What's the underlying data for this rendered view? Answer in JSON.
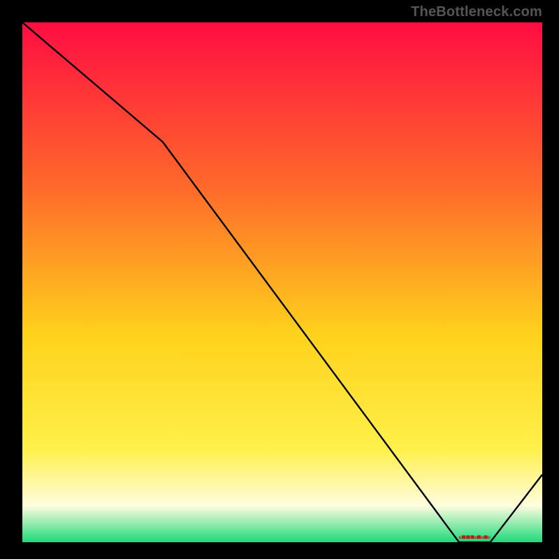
{
  "watermark": "TheBottleneck.com",
  "colors": {
    "grad_top": "#ff0d42",
    "grad_upper_mid": "#ff6a2a",
    "grad_mid": "#ffd21c",
    "grad_low_yellow": "#fff04a",
    "grad_pale": "#fffde0",
    "grad_green": "#1fd97a",
    "line": "#000000",
    "marker": "#b3231a",
    "border": "#000000"
  },
  "chart_data": {
    "type": "line",
    "title": "",
    "xlabel": "",
    "ylabel": "",
    "xlim": [
      0,
      100
    ],
    "ylim": [
      0,
      100
    ],
    "x": [
      0,
      27,
      84,
      90,
      100
    ],
    "values": [
      100,
      77,
      0,
      0,
      13
    ],
    "flat_segment": {
      "x_start": 84,
      "x_end": 90,
      "y": 0
    },
    "marker_label": "■■■ ■ ■"
  }
}
